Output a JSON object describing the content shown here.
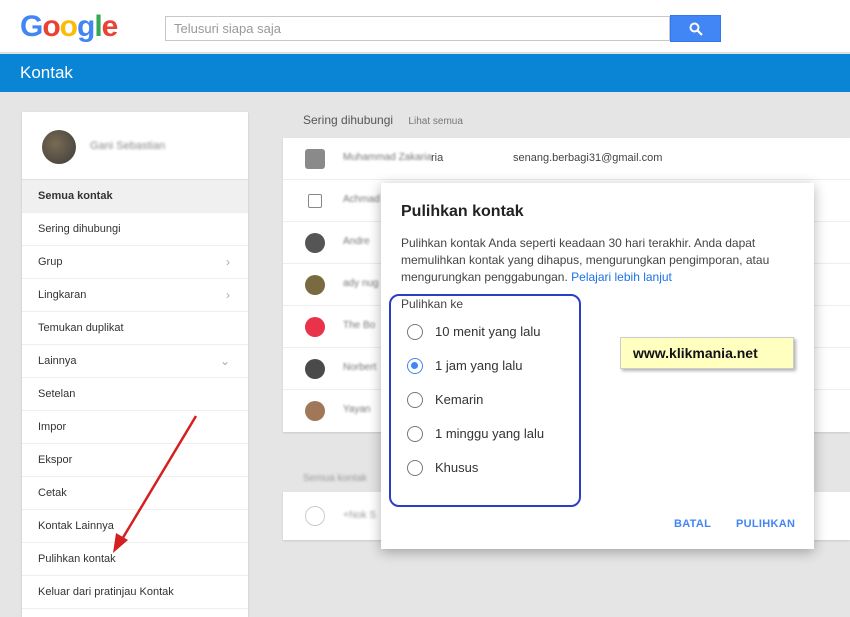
{
  "header": {
    "logo_letters": [
      {
        "ch": "G",
        "color": "#4285f4"
      },
      {
        "ch": "o",
        "color": "#ea4335"
      },
      {
        "ch": "o",
        "color": "#fbbc05"
      },
      {
        "ch": "g",
        "color": "#4285f4"
      },
      {
        "ch": "l",
        "color": "#34a853"
      },
      {
        "ch": "e",
        "color": "#ea4335"
      }
    ],
    "search_placeholder": "Telusuri siapa saja",
    "search_icon": "search-icon"
  },
  "app_title": "Kontak",
  "sidebar": {
    "items": [
      {
        "label": "Semua kontak",
        "active": true
      },
      {
        "label": "Sering dihubungi"
      },
      {
        "label": "Grup",
        "chevron": "›"
      },
      {
        "label": "Lingkaran",
        "chevron": "›"
      },
      {
        "label": "Temukan duplikat"
      },
      {
        "label": "Lainnya",
        "chevron": "⌄"
      },
      {
        "label": "Setelan"
      },
      {
        "label": "Impor"
      },
      {
        "label": "Ekspor"
      },
      {
        "label": "Cetak"
      },
      {
        "label": "Kontak Lainnya"
      },
      {
        "label": "Pulihkan kontak"
      },
      {
        "label": "Keluar dari pratinjau Kontak"
      }
    ]
  },
  "main": {
    "section_title": "Sering dihubungi",
    "see_all": "Lihat semua",
    "first_row_email": "senang.berbagi31@gmail.com",
    "first_row_name_suffix": "ria"
  },
  "dialog": {
    "title": "Pulihkan kontak",
    "description": "Pulihkan kontak Anda seperti keadaan 30 hari terakhir. Anda dapat memulihkan kontak yang dihapus, mengurungkan pengimporan, atau mengurungkan penggabungan.",
    "learn_more": "Pelajari lebih lanjut",
    "restore_to_label": "Pulihkan ke",
    "options": [
      {
        "label": "10 menit yang lalu",
        "selected": false
      },
      {
        "label": "1 jam yang lalu",
        "selected": true
      },
      {
        "label": "Kemarin",
        "selected": false
      },
      {
        "label": "1 minggu yang lalu",
        "selected": false
      },
      {
        "label": "Khusus",
        "selected": false
      }
    ],
    "cancel_label": "BATAL",
    "restore_label": "PULIHKAN"
  },
  "watermark": "www.klikmania.net",
  "colors": {
    "brand_blue": "#0a84d4",
    "accent": "#4285f4",
    "annotation_box": "#2c3ec7",
    "arrow": "#d52020"
  }
}
